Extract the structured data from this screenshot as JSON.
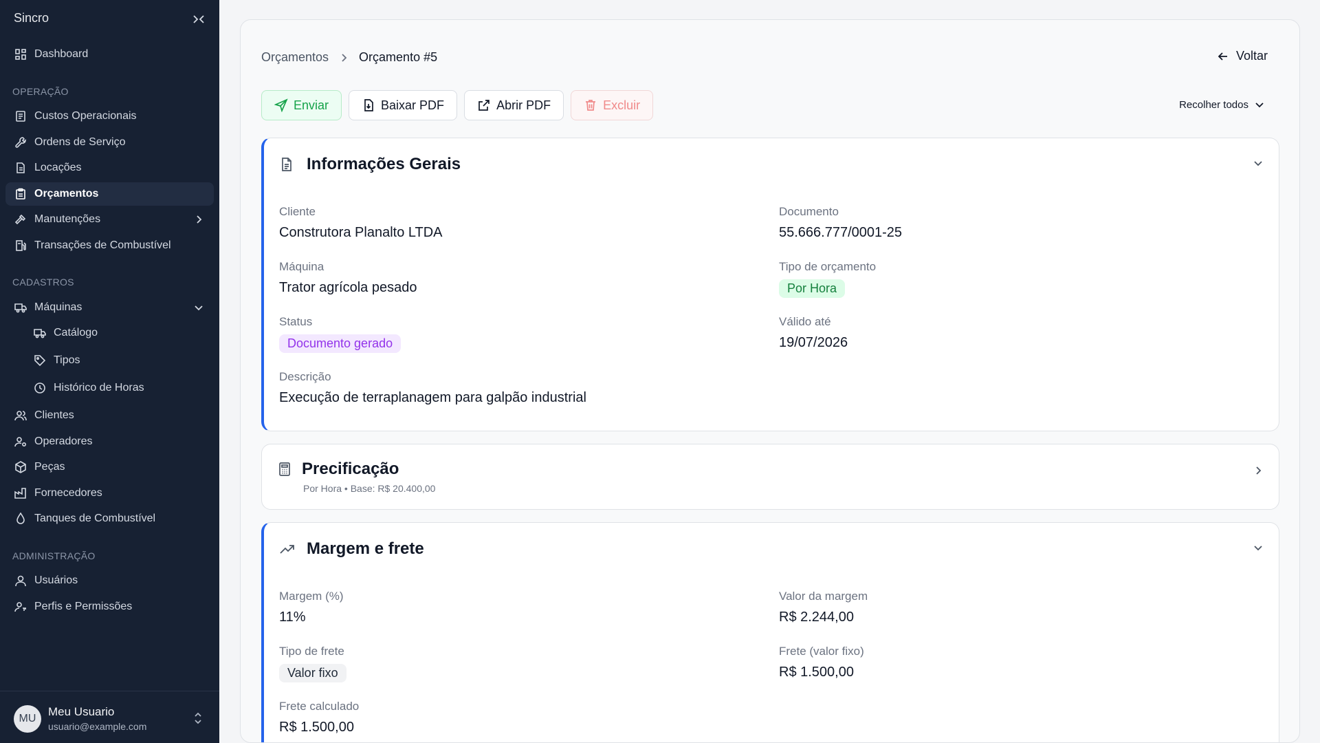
{
  "sidebar": {
    "brand": "Sincro",
    "dashboard": "Dashboard",
    "sections": {
      "operacao": "OPERAÇÃO",
      "cadastros": "CADASTROS",
      "administracao": "ADMINISTRAÇÃO"
    },
    "items": {
      "custos": "Custos Operacionais",
      "ordens": "Ordens de Serviço",
      "locacoes": "Locações",
      "orcamentos": "Orçamentos",
      "manutencoes": "Manutenções",
      "transacoes": "Transações de Combustível",
      "maquinas": "Máquinas",
      "catalogo": "Catálogo",
      "tipos": "Tipos",
      "historico": "Histórico de Horas",
      "clientes": "Clientes",
      "operadores": "Operadores",
      "pecas": "Peças",
      "fornecedores": "Fornecedores",
      "tanques": "Tanques de Combustível",
      "usuarios": "Usuários",
      "perfis": "Perfis e Permissões"
    },
    "user": {
      "initials": "MU",
      "name": "Meu Usuario",
      "email": "usuario@example.com"
    }
  },
  "header": {
    "breadcrumb_parent": "Orçamentos",
    "breadcrumb_current": "Orçamento #5",
    "back_label": "Voltar"
  },
  "toolbar": {
    "send": "Enviar",
    "download_pdf": "Baixar PDF",
    "open_pdf": "Abrir PDF",
    "delete": "Excluir",
    "collapse_all": "Recolher todos"
  },
  "info": {
    "title": "Informações Gerais",
    "cliente_label": "Cliente",
    "cliente": "Construtora Planalto LTDA",
    "documento_label": "Documento",
    "documento": "55.666.777/0001-25",
    "maquina_label": "Máquina",
    "maquina": "Trator agrícola pesado",
    "tipo_label": "Tipo de orçamento",
    "tipo": "Por Hora",
    "status_label": "Status",
    "status": "Documento gerado",
    "valido_label": "Válido até",
    "valido": "19/07/2026",
    "descricao_label": "Descrição",
    "descricao": "Execução de terraplanagem para galpão industrial"
  },
  "pricing": {
    "title": "Precificação",
    "subtitle": "Por Hora • Base: R$ 20.400,00"
  },
  "margin": {
    "title": "Margem e frete",
    "margem_label": "Margem (%)",
    "margem": "11%",
    "valor_margem_label": "Valor da margem",
    "valor_margem": "R$ 2.244,00",
    "tipo_frete_label": "Tipo de frete",
    "tipo_frete": "Valor fixo",
    "frete_fixo_label": "Frete (valor fixo)",
    "frete_fixo": "R$ 1.500,00",
    "frete_calc_label": "Frete calculado",
    "frete_calc": "R$ 1.500,00"
  },
  "colors": {
    "sidebar_bg": "#172133",
    "accent": "#2563eb",
    "success": "#16a34a",
    "danger": "#f08a8a",
    "status_purple": "#9333ea"
  }
}
